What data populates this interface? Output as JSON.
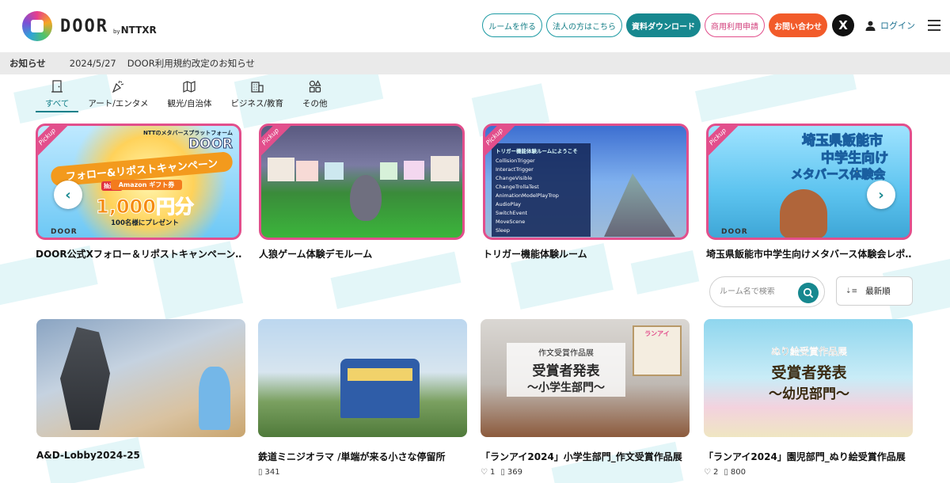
{
  "header": {
    "logo_text": "DOOR",
    "logo_by": "by",
    "logo_company": "NTTXR",
    "nav": {
      "create_room": "ルームを作る",
      "for_business": "法人の方はこちら",
      "download_docs": "資料ダウンロード",
      "commercial_apply": "商用利用申請",
      "contact": "お問い合わせ",
      "x_label": "X",
      "login": "ログイン"
    }
  },
  "notice": {
    "label": "お知らせ",
    "date": "2024/5/27",
    "text": "DOOR利用規約改定のお知らせ"
  },
  "categories": [
    {
      "label": "すべて",
      "icon": "door-icon",
      "active": true
    },
    {
      "label": "アート/エンタメ",
      "icon": "party-popper-icon",
      "active": false
    },
    {
      "label": "観光/自治体",
      "icon": "map-icon",
      "active": false
    },
    {
      "label": "ビジネス/教育",
      "icon": "building-icon",
      "active": false
    },
    {
      "label": "その他",
      "icon": "shapes-icon",
      "active": false
    }
  ],
  "pickup": {
    "badge": "Pickup",
    "items": [
      {
        "title": "DOOR公式Xフォロー＆リポストキャンペーン…",
        "thumb": {
          "top_caption": "NTTのメタバースプラットフォーム",
          "brand": "DOOR",
          "banner": "フォロー&リポストキャンペーン",
          "gift": "Amazon ギフト券",
          "amount": "1,000円分",
          "recipients": "100名様にプレゼント",
          "tag": "抽選で",
          "logo": "DOOR"
        }
      },
      {
        "title": "人狼ゲーム体験デモルーム"
      },
      {
        "title": "トリガー機能体験ルーム",
        "thumb": {
          "panel_title": "トリガー機能体験ルームにようこそ",
          "lines": [
            "CollisionTrigger",
            "InteractTrigger",
            "ChangeVisible",
            "ChangeTrollaTest",
            "AnimationModelPlayTrop",
            "AudioPlay",
            "SwitchEvent",
            "MoveScene",
            "Sleep"
          ]
        }
      },
      {
        "title": "埼玉県飯能市中学生向けメタバース体験会レポ…",
        "thumb": {
          "line1": "埼玉県飯能市",
          "line2": "中学生向け",
          "line3": "メタバース体験会",
          "logo": "DOOR"
        }
      }
    ],
    "prev_arrow": "‹",
    "next_arrow": "›"
  },
  "search": {
    "placeholder": "ルーム名で検索"
  },
  "sort": {
    "label": "最新順",
    "icon": "sort-icon"
  },
  "rooms": [
    {
      "title": "A&D-Lobby2024-25",
      "likes": "",
      "views": ""
    },
    {
      "title": "鉄道ミニジオラマ /単端が来る小さな停留所",
      "likes": "",
      "views": "341"
    },
    {
      "title": "「ランアイ2024」小学生部門_作文受賞作品展",
      "likes": "1",
      "views": "369",
      "thumb": {
        "line1": "作文受賞作品展",
        "line2": "受賞者発表",
        "line3": "〜小学生部門〜",
        "sign": "ランアイ"
      }
    },
    {
      "title": "「ランアイ2024」園児部門_ぬり絵受賞作品展",
      "likes": "2",
      "views": "800",
      "thumb": {
        "line1": "ぬり絵受賞作品展",
        "line2": "受賞者発表",
        "line3": "〜幼児部門〜"
      }
    }
  ],
  "colors": {
    "teal": "#17888f",
    "pink": "#e24f8c",
    "orange": "#f25b2a",
    "notice_bg": "#eaeaea"
  }
}
